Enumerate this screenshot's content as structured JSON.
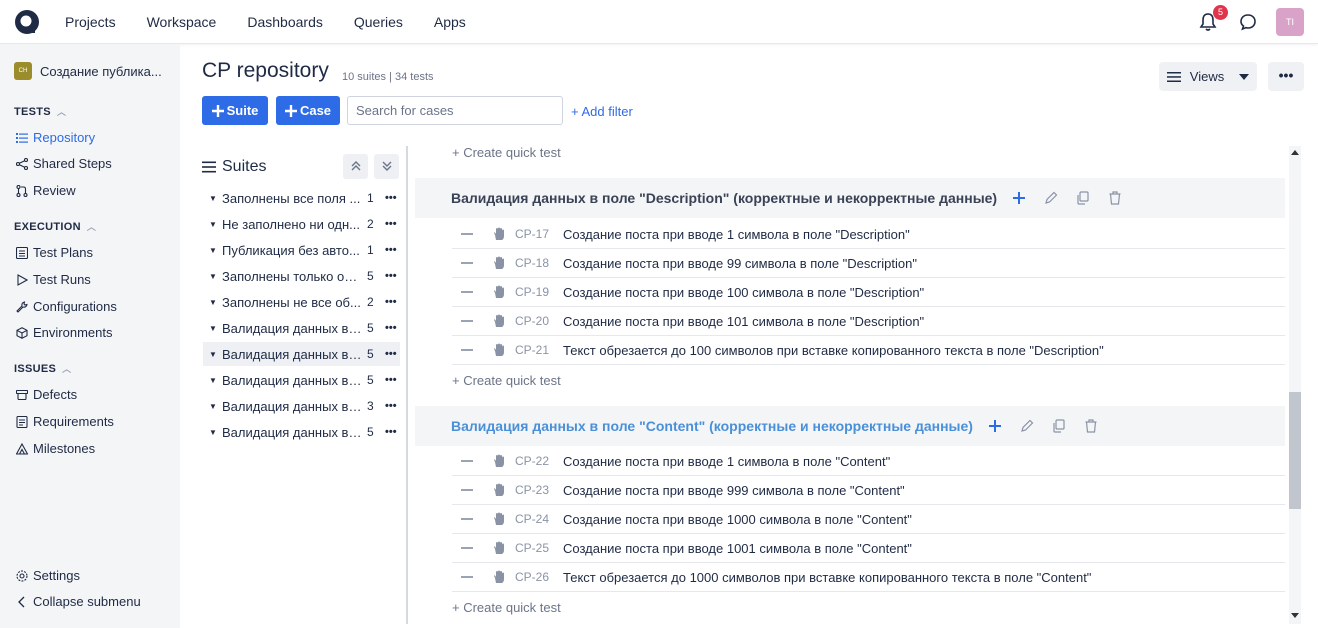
{
  "nav": {
    "items": [
      "Projects",
      "Workspace",
      "Dashboards",
      "Queries",
      "Apps"
    ],
    "notifications_count": "5",
    "user_initials": "TI"
  },
  "project": {
    "initials": "CH",
    "name": "Создание публика..."
  },
  "sidebar": {
    "tests_title": "TESTS",
    "tests_items": [
      "Repository",
      "Shared Steps",
      "Review"
    ],
    "execution_title": "EXECUTION",
    "execution_items": [
      "Test Plans",
      "Test Runs",
      "Configurations",
      "Environments"
    ],
    "issues_title": "ISSUES",
    "issues_items": [
      "Defects",
      "Requirements",
      "Milestones"
    ],
    "settings": "Settings",
    "collapse": "Collapse submenu"
  },
  "header": {
    "title": "CP repository",
    "subtitle": "10 suites | 34 tests",
    "views_label": "Views",
    "suite_button": "Suite",
    "case_button": "Case",
    "search_placeholder": "Search for cases",
    "add_filter": "+ Add filter"
  },
  "suites": {
    "title": "Suites",
    "items": [
      {
        "name": "Заполнены все поля ...",
        "count": "1"
      },
      {
        "name": "Не заполнено ни одн...",
        "count": "2"
      },
      {
        "name": "Публикация без авто...",
        "count": "1"
      },
      {
        "name": "Заполнены только об...",
        "count": "5"
      },
      {
        "name": "Заполнены не все об...",
        "count": "2"
      },
      {
        "name": "Валидация данных в ...",
        "count": "5"
      },
      {
        "name": "Валидация данных в ...",
        "count": "5"
      },
      {
        "name": "Валидация данных в ...",
        "count": "5"
      },
      {
        "name": "Валидация данных в ...",
        "count": "3"
      },
      {
        "name": "Валидация данных в ...",
        "count": "5"
      }
    ]
  },
  "main": {
    "quick_test": "+ Create quick test",
    "groups": [
      {
        "title": "Валидация данных в поле \"Description\" (корректные и некорректные данные)",
        "cases": [
          {
            "id": "CP-17",
            "title": "Создание поста при вводе 1 символа в поле \"Description\""
          },
          {
            "id": "CP-18",
            "title": "Создание поста при вводе 99 символа в поле \"Description\""
          },
          {
            "id": "CP-19",
            "title": "Создание поста при вводе 100 символа в поле \"Description\""
          },
          {
            "id": "CP-20",
            "title": "Создание поста при вводе 101 символа в поле \"Description\""
          },
          {
            "id": "CP-21",
            "title": "Текст обрезается до 100 символов при вставке копированного текста в поле \"Description\""
          }
        ]
      },
      {
        "title": "Валидация данных в поле \"Content\" (корректные и некорректные данные)",
        "cases": [
          {
            "id": "CP-22",
            "title": "Создание поста при вводе 1 символа в поле \"Content\""
          },
          {
            "id": "CP-23",
            "title": "Создание поста при вводе 999 символа в поле \"Content\""
          },
          {
            "id": "CP-24",
            "title": "Создание поста при вводе 1000 символа в поле \"Content\""
          },
          {
            "id": "CP-25",
            "title": "Создание поста при вводе 1001 символа в поле \"Content\""
          },
          {
            "id": "CP-26",
            "title": "Текст обрезается до 1000 символов при вставке копированного текста в поле \"Content\""
          }
        ]
      }
    ]
  },
  "colors": {
    "accent": "#2e6be6",
    "badge": "#e0364c",
    "group_title_highlight": "#4a90d9"
  }
}
